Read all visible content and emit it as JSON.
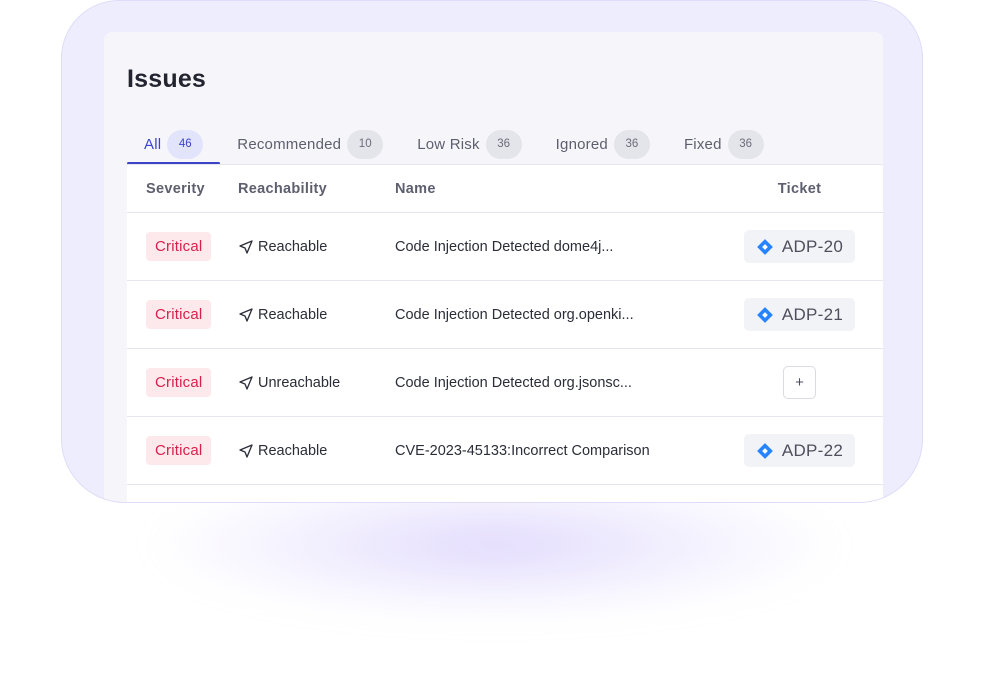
{
  "page": {
    "title": "Issues"
  },
  "tabs": [
    {
      "label": "All",
      "count": "46"
    },
    {
      "label": "Recommended",
      "count": "10"
    },
    {
      "label": "Low Risk",
      "count": "36"
    },
    {
      "label": "Ignored",
      "count": "36"
    },
    {
      "label": "Fixed",
      "count": "36"
    }
  ],
  "table": {
    "headers": {
      "severity": "Severity",
      "reachability": "Reachability",
      "name": "Name",
      "ticket": "Ticket"
    },
    "rows": [
      {
        "severity": "Critical",
        "reachability": "Reachable",
        "name": "Code Injection Detected dome4j...",
        "ticket": "ADP-20"
      },
      {
        "severity": "Critical",
        "reachability": "Reachable",
        "name": "Code Injection Detected org.openki...",
        "ticket": "ADP-21"
      },
      {
        "severity": "Critical",
        "reachability": "Unreachable",
        "name": "Code Injection Detected org.jsonsc...",
        "ticket": "",
        "add_label": "+"
      },
      {
        "severity": "Critical",
        "reachability": "Reachable",
        "name": "CVE-2023-45133:Incorrect Comparison",
        "ticket": "ADP-22"
      }
    ]
  },
  "colors": {
    "accent": "#3a44c7",
    "critical_text": "#d7204a",
    "critical_bg": "#fde9ec",
    "jira_blue": "#2684ff"
  },
  "icons": {
    "reachability": "navigation-arrow-icon",
    "ticket": "jira-icon"
  }
}
